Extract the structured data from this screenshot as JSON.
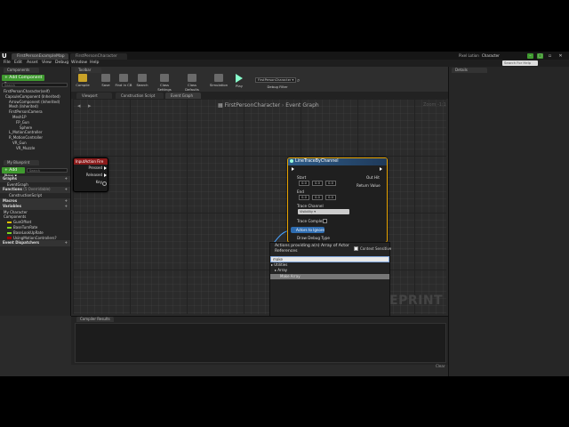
{
  "window": {
    "tabs": [
      "FirstPersonExampleMap",
      "FirstPersonCharacter"
    ],
    "title_right": "Pixel Lotion",
    "title_right_sub": "Character",
    "search_placeholder": "Search For Help",
    "icons": [
      "minimize-icon",
      "maximize-icon",
      "close-icon"
    ]
  },
  "menubar": {
    "items": [
      "File",
      "Edit",
      "Asset",
      "View",
      "Debug",
      "Window",
      "Help"
    ]
  },
  "left_panel": {
    "components_tab": "Components",
    "add_component": "+ Add Component ▾",
    "search_placeholder": "Search",
    "tree": [
      "FirstPersonCharacter(self)",
      "CapsuleComponent (Inherited)",
      "ArrowComponent (Inherited)",
      "Mesh (Inherited)",
      "FirstPersonCamera",
      "Mesh1P",
      "FP_Gun",
      "Sphere",
      "L_MotionController",
      "R_MotionController",
      "VR_Gun",
      "VR_Muzzle"
    ],
    "mb_tab": "My Blueprint",
    "add_new": "+ Add New ▾",
    "mb_search": "Search",
    "graphs_head": "Graphs",
    "event_graph": "EventGraph",
    "functions_head": "Functions",
    "functions_note": "(5 Overridable)",
    "construction": "ConstructionScript",
    "macros_head": "Macros",
    "variables_head": "Variables",
    "my_character": "My Character",
    "components_head": "Components",
    "variables": [
      {
        "name": "GunOffset",
        "color": "#e6c000"
      },
      {
        "name": "BaseTurnRate",
        "color": "#7ed321"
      },
      {
        "name": "BaseLookUpRate",
        "color": "#7ed321"
      },
      {
        "name": "UsingMotionControllers?",
        "color": "#a10000"
      }
    ],
    "dispatchers_head": "Event Dispatchers"
  },
  "toolbar": {
    "tab": "Toolbar",
    "buttons": [
      "Compile",
      "Save",
      "Find in CB",
      "Search",
      "Class Settings",
      "Class Defaults",
      "Simulation",
      "Play"
    ],
    "debug_select": "FirstPersonCharacter ▾",
    "debug_label": "Debug Filter"
  },
  "graph": {
    "tabs": [
      "Viewport",
      "Construction Script",
      "Event Graph"
    ],
    "crumb_root": "FirstPersonCharacter",
    "crumb_leaf": "Event Graph",
    "zoom": "Zoom -1:1",
    "watermark": "EPRINT"
  },
  "input_node": {
    "title": "InputAction Fire",
    "pins": [
      "Pressed",
      "Released",
      "Key"
    ]
  },
  "trace_node": {
    "title": "LineTraceByChannel",
    "start": "Start",
    "end": "End",
    "out_hit": "Out Hit",
    "return_value": "Return Value",
    "start_vals": [
      "0.0",
      "0.0",
      "0.0"
    ],
    "end_vals": [
      "0.0",
      "0.0",
      "0.0"
    ],
    "trace_channel": "Trace Channel",
    "channel_value": "Visibility ▾",
    "trace_complex": "Trace Complex",
    "actors_ignore": "Actors to Ignore",
    "draw_debug": "Draw Debug Type"
  },
  "context_menu": {
    "title": "Actions providing a(n) Array of Actor References",
    "context_sensitive": "Context Sensitive",
    "search_value": "make",
    "rows": [
      {
        "label": "▸ Utilities",
        "indent": 0,
        "selected": false
      },
      {
        "label": "▸ Array",
        "indent": 4,
        "selected": false
      },
      {
        "label": "Make Array",
        "indent": 10,
        "selected": true
      }
    ]
  },
  "compiler": {
    "tab": "Compiler Results",
    "clear": "Clear"
  },
  "details": {
    "tab": "Details"
  }
}
